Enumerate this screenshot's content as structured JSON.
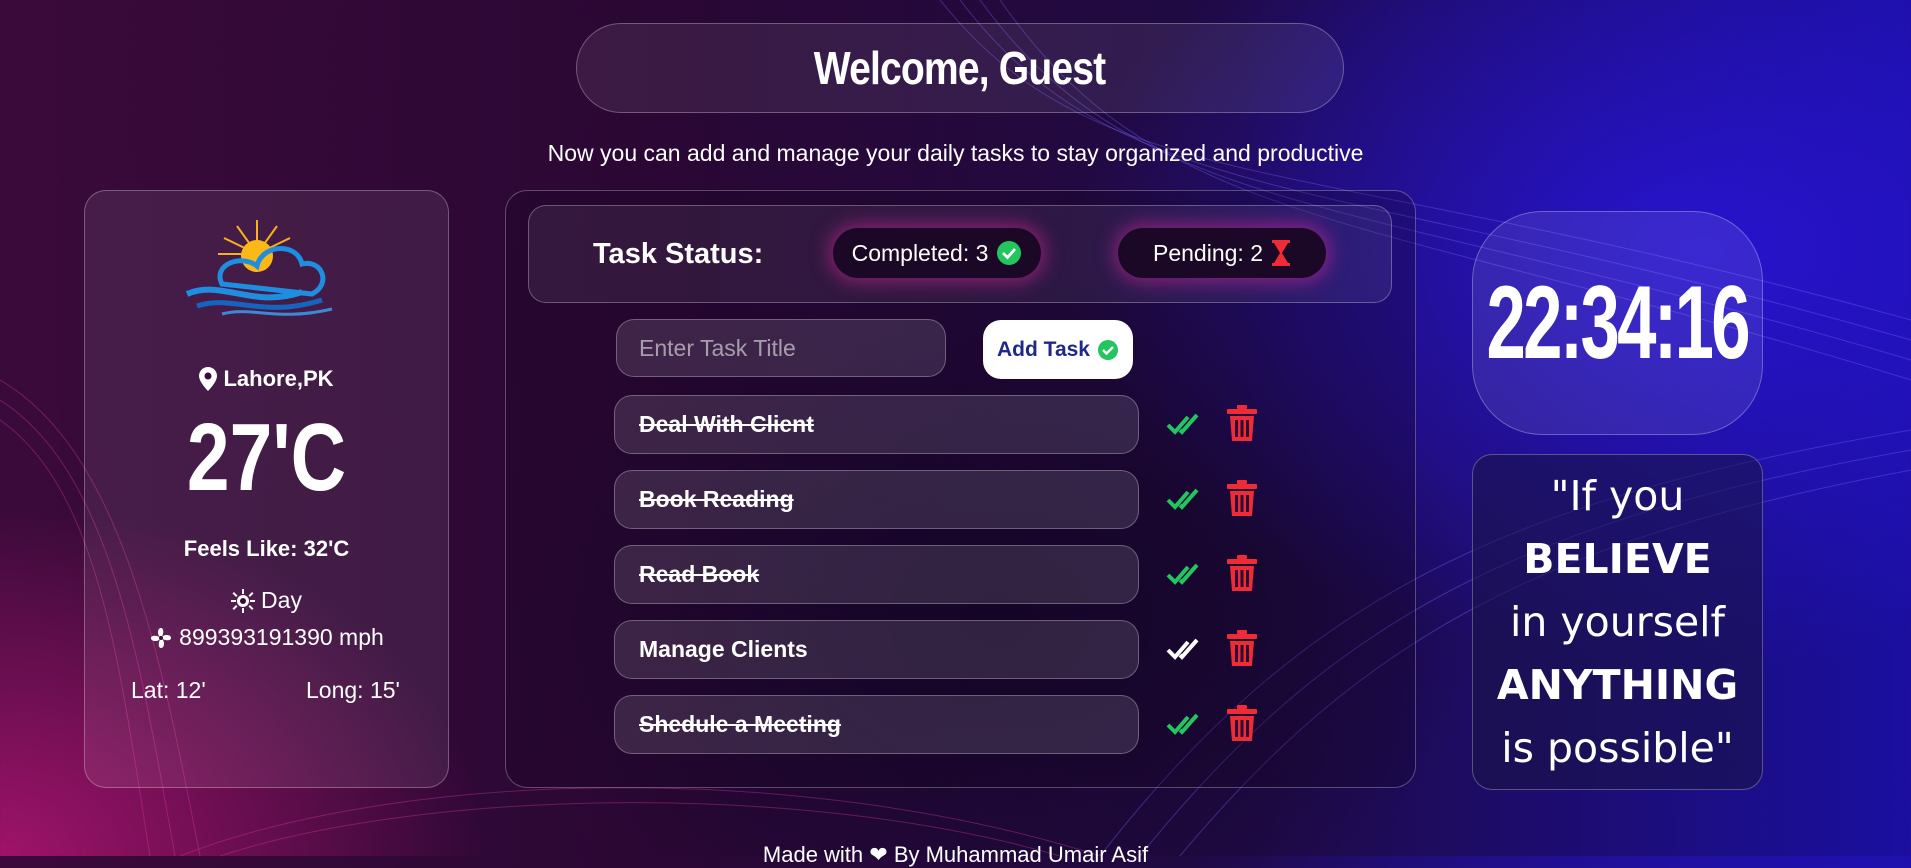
{
  "header": {
    "title": "Welcome, Guest"
  },
  "subtitle": "Now you can add and manage your daily tasks to stay organized and productive",
  "weather": {
    "location": "Lahore,PK",
    "temperature": "27'C",
    "feels_like": "Feels Like: 32'C",
    "period": "Day",
    "wind": "899393191390 mph",
    "lat": "Lat: 12'",
    "long": "Long: 15'"
  },
  "status": {
    "label": "Task Status:",
    "completed": "Completed: 3",
    "pending": "Pending: 2"
  },
  "form": {
    "placeholder": "Enter Task Title",
    "add_label": "Add Task"
  },
  "tasks": [
    {
      "title": "Deal With Client",
      "done": true
    },
    {
      "title": "Book Reading",
      "done": true
    },
    {
      "title": "Read Book",
      "done": true
    },
    {
      "title": "Manage Clients",
      "done": false
    },
    {
      "title": "Shedule a Meeting",
      "done": true
    }
  ],
  "clock": {
    "time": "22:34:16"
  },
  "quote": {
    "line1": "\"If you",
    "line2": "BELIEVE",
    "line3": "in yourself",
    "line4": "ANYTHING",
    "line5": "is possible\""
  },
  "footer": {
    "text": "Made with ❤ By Muhammad Umair Asif"
  },
  "colors": {
    "done_check": "#22c55e",
    "pending_check": "#ffffff",
    "delete": "#ef2b36",
    "completed_badge": "#22c55e",
    "pending_badge": "#ef2b36"
  }
}
